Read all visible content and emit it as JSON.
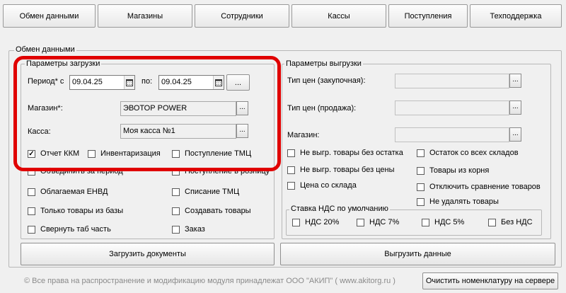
{
  "tabs": [
    {
      "label": "Обмен данными"
    },
    {
      "label": "Магазины"
    },
    {
      "label": "Сотрудники"
    },
    {
      "label": "Кассы"
    },
    {
      "label": "Поступления"
    },
    {
      "label": "Техподдержка"
    }
  ],
  "exchange": {
    "title": "Обмен данными",
    "load": {
      "title": "Параметры загрузки",
      "period_from_label": "Период* с",
      "period_from_value": "09.04.25",
      "period_to_label": "по:",
      "period_to_value": "09.04.25",
      "more_button": "...",
      "store_label": "Магазин*:",
      "store_value": "ЭВОТОР POWER",
      "register_label": "Касса:",
      "register_value": "Моя касса №1",
      "checks_left": [
        {
          "label": "Отчет ККМ",
          "checked": true
        },
        {
          "label": "Объединить за период",
          "checked": false
        },
        {
          "label": "Облагаемая ЕНВД",
          "checked": false
        },
        {
          "label": "Только товары из базы",
          "checked": false
        },
        {
          "label": "Свернуть таб часть",
          "checked": false
        }
      ],
      "checks_mid_first": {
        "label": "Инвентаризация",
        "checked": false
      },
      "checks_right": [
        {
          "label": "Поступление ТМЦ",
          "checked": false
        },
        {
          "label": "Поступление в розницу",
          "checked": false
        },
        {
          "label": "Списание ТМЦ",
          "checked": false
        },
        {
          "label": "Создавать товары",
          "checked": false
        },
        {
          "label": "Заказ",
          "checked": false
        }
      ],
      "load_button": "Загрузить документы"
    },
    "unload": {
      "title": "Параметры выгрузки",
      "price_buy_label": "Тип цен (закупочная):",
      "price_sell_label": "Тип цен (продажа):",
      "store_label": "Магазин:",
      "checks_left": [
        {
          "label": "Не выгр. товары без остатка",
          "checked": false
        },
        {
          "label": "Не выгр. товары без цены",
          "checked": false
        },
        {
          "label": "Цена со склада",
          "checked": false
        }
      ],
      "checks_right": [
        {
          "label": "Остаток со всех складов",
          "checked": false
        },
        {
          "label": "Товары из корня",
          "checked": false
        },
        {
          "label": "Отключить сравнение товаров",
          "checked": false
        },
        {
          "label": "Не удалять товары",
          "checked": false
        }
      ],
      "vat": {
        "title": "Ставка НДС по умолчанию",
        "options": [
          {
            "label": "НДС 20%",
            "checked": false
          },
          {
            "label": "НДС 7%",
            "checked": false
          },
          {
            "label": "НДС 5%",
            "checked": false
          },
          {
            "label": "Без НДС",
            "checked": false
          }
        ]
      },
      "unload_button": "Выгрузить данные"
    }
  },
  "footer": {
    "copyright": "© Все права на распространение и модификацию модуля принадлежат ООО \"АКИП\" ( www.akitorg.ru )",
    "clear_button": "Очистить номенклатуру на сервере"
  },
  "colors": {
    "highlight": "#e00000"
  }
}
